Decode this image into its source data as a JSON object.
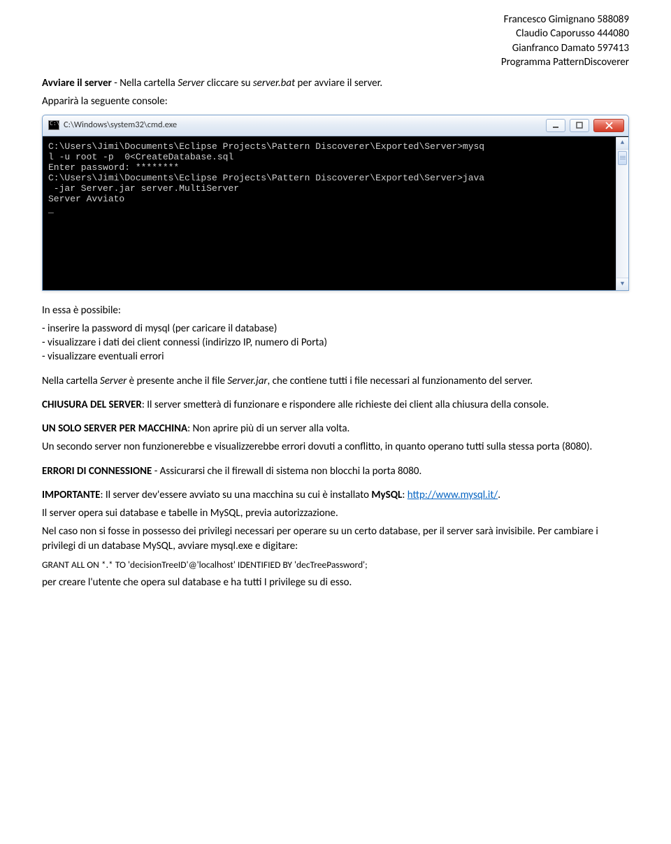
{
  "header": {
    "lines": [
      "Francesco Gimignano 588089",
      "Claudio Caporusso 444080",
      "Gianfranco Damato 597413",
      "Programma PatternDiscoverer"
    ]
  },
  "para1": {
    "bold": "Avviare il server",
    "rest_a": " - Nella cartella ",
    "italic1": "Server",
    "rest_b": " cliccare su ",
    "italic2": "server.bat",
    "rest_c": " per avviare il server."
  },
  "para2": "Apparirà la seguente console:",
  "console": {
    "title": "C:\\Windows\\system32\\cmd.exe",
    "lines": [
      "",
      "C:\\Users\\Jimi\\Documents\\Eclipse Projects\\Pattern Discoverer\\Exported\\Server>mysq",
      "l -u root -p  0<CreateDatabase.sql",
      "Enter password: ********",
      "",
      "C:\\Users\\Jimi\\Documents\\Eclipse Projects\\Pattern Discoverer\\Exported\\Server>java",
      " -jar Server.jar server.MultiServer",
      "Server Avviato",
      "_"
    ]
  },
  "after_console_intro": "In essa è possibile:",
  "bullets": [
    "inserire la password di mysql (per caricare il database)",
    "visualizzare i dati dei client connessi (indirizzo IP, numero di Porta)",
    "visualizzare eventuali errori"
  ],
  "para3": {
    "a": "Nella cartella ",
    "i1": "Server",
    "b": " è presente anche il file ",
    "i2": "Server.jar",
    "c": ", che contiene tutti i file necessari al funzionamento del server."
  },
  "para4": {
    "bold": "CHIUSURA DEL SERVER",
    "rest": ": Il server smetterà di funzionare e rispondere alle richieste dei client alla chiusura della console."
  },
  "para5": {
    "bold": "UN SOLO SERVER PER MACCHINA",
    "rest": ": Non aprire più di un server alla volta."
  },
  "para5b": "Un secondo server non funzionerebbe e visualizzerebbe errori dovuti a conflitto, in quanto operano tutti sulla stessa porta (8080).",
  "para6": {
    "bold": "ERRORI DI CONNESSIONE",
    "rest": " - Assicurarsi che il firewall di sistema non blocchi la porta 8080."
  },
  "para7": {
    "bold": "IMPORTANTE",
    "a": ": Il server dev'essere avviato su una macchina su cui è installato ",
    "bold2": "MySQL",
    "b": ": ",
    "link": "http://www.mysql.it/",
    "c": "."
  },
  "para7b": "Il server opera sui database e tabelle in MySQL, previa autorizzazione.",
  "para7c": "Nel caso non si fosse in possesso dei privilegi necessari per operare su un certo database, per il server sarà invisibile. Per cambiare i privilegi di un database MySQL, avviare mysql.exe e digitare:",
  "grant": "GRANT ALL ON *.* TO 'decisionTreeID'@'localhost' IDENTIFIED BY 'decTreePassword';",
  "para8": "per creare l'utente che opera sul database e ha tutti I privilege su di esso."
}
